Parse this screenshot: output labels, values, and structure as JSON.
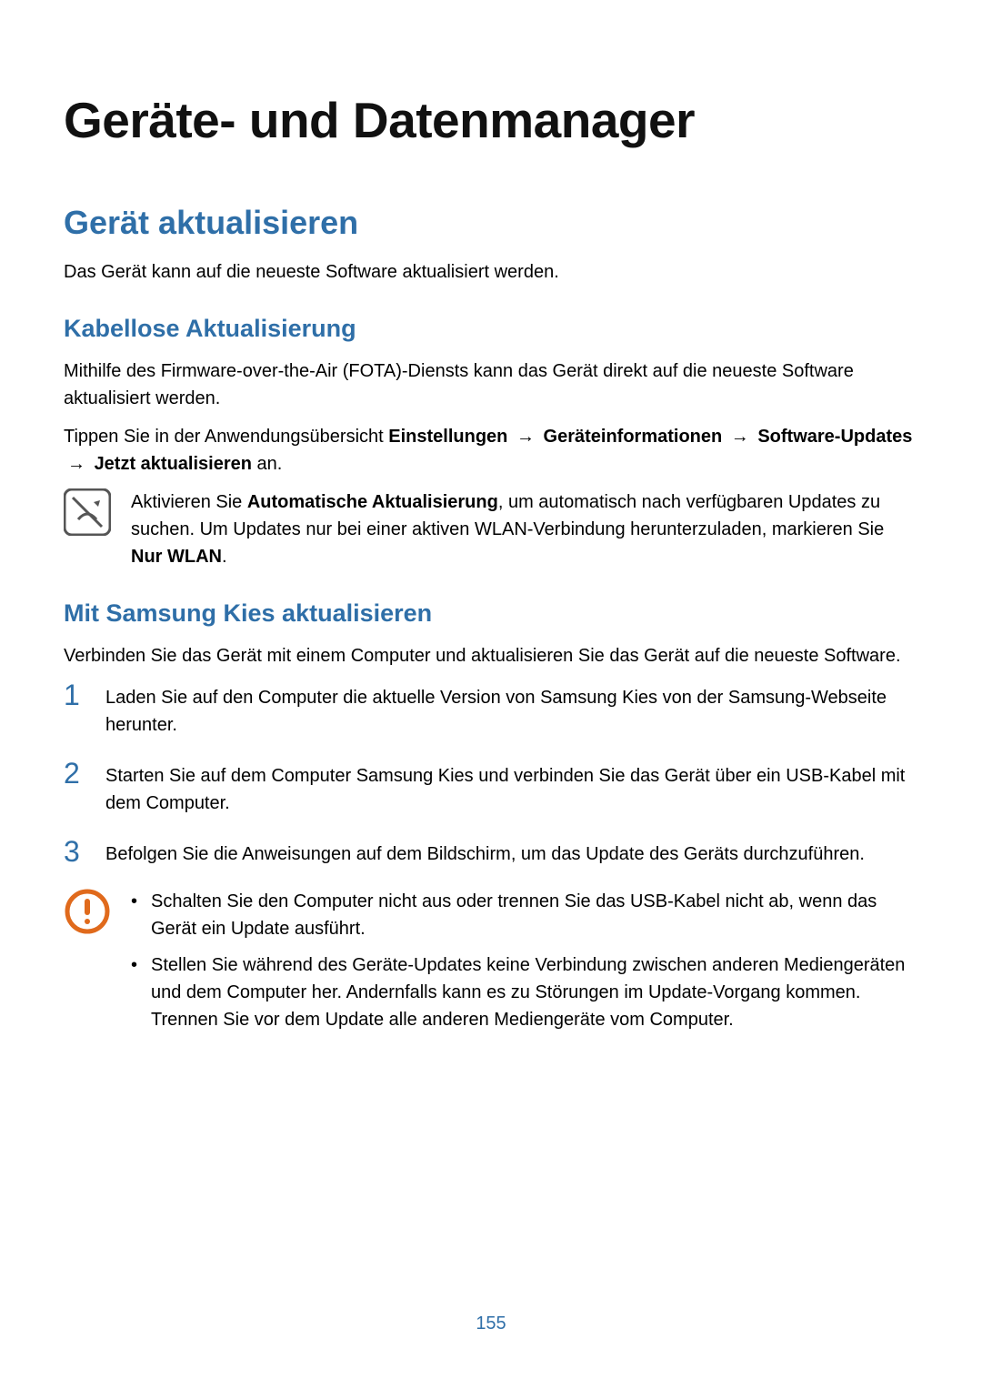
{
  "title": "Geräte- und Datenmanager",
  "section1": {
    "heading": "Gerät aktualisieren",
    "intro": "Das Gerät kann auf die neueste Software aktualisiert werden."
  },
  "sub1": {
    "heading": "Kabellose Aktualisierung",
    "p1": "Mithilfe des Firmware-over-the-Air (FOTA)-Diensts kann das Gerät direkt auf die neueste Software aktualisiert werden.",
    "p2_prefix": "Tippen Sie in der Anwendungsübersicht ",
    "p2_b1": "Einstellungen",
    "p2_arrow": "→",
    "p2_b2": "Geräteinformationen",
    "p2_b3": "Software-Updates",
    "p2_b4": "Jetzt aktualisieren",
    "p2_suffix": " an.",
    "note_prefix": "Aktivieren Sie ",
    "note_b1": "Automatische Aktualisierung",
    "note_mid": ", um automatisch nach verfügbaren Updates zu suchen. Um Updates nur bei einer aktiven WLAN-Verbindung herunterzuladen, markieren Sie ",
    "note_b2": "Nur WLAN",
    "note_suffix": "."
  },
  "sub2": {
    "heading": "Mit Samsung Kies aktualisieren",
    "intro": "Verbinden Sie das Gerät mit einem Computer und aktualisieren Sie das Gerät auf die neueste Software.",
    "steps": [
      {
        "n": "1",
        "t": "Laden Sie auf den Computer die aktuelle Version von Samsung Kies von der Samsung-Webseite herunter."
      },
      {
        "n": "2",
        "t": "Starten Sie auf dem Computer Samsung Kies und verbinden Sie das Gerät über ein USB-Kabel mit dem Computer."
      },
      {
        "n": "3",
        "t": "Befolgen Sie die Anweisungen auf dem Bildschirm, um das Update des Geräts durchzuführen."
      }
    ],
    "warn": [
      "Schalten Sie den Computer nicht aus oder trennen Sie das USB-Kabel nicht ab, wenn das Gerät ein Update ausführt.",
      "Stellen Sie während des Geräte-Updates keine Verbindung zwischen anderen Mediengeräten und dem Computer her. Andernfalls kann es zu Störungen im Update-Vorgang kommen. Trennen Sie vor dem Update alle anderen Mediengeräte vom Computer."
    ]
  },
  "page_number": "155",
  "bullet": "•"
}
